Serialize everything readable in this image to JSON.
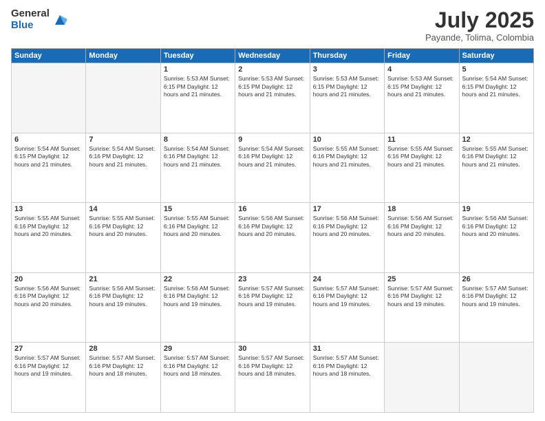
{
  "logo": {
    "general": "General",
    "blue": "Blue"
  },
  "header": {
    "month": "July 2025",
    "location": "Payande, Tolima, Colombia"
  },
  "weekdays": [
    "Sunday",
    "Monday",
    "Tuesday",
    "Wednesday",
    "Thursday",
    "Friday",
    "Saturday"
  ],
  "weeks": [
    [
      {
        "day": "",
        "empty": true
      },
      {
        "day": "",
        "empty": true
      },
      {
        "day": "1",
        "info": "Sunrise: 5:53 AM\nSunset: 6:15 PM\nDaylight: 12 hours and 21 minutes."
      },
      {
        "day": "2",
        "info": "Sunrise: 5:53 AM\nSunset: 6:15 PM\nDaylight: 12 hours and 21 minutes."
      },
      {
        "day": "3",
        "info": "Sunrise: 5:53 AM\nSunset: 6:15 PM\nDaylight: 12 hours and 21 minutes."
      },
      {
        "day": "4",
        "info": "Sunrise: 5:53 AM\nSunset: 6:15 PM\nDaylight: 12 hours and 21 minutes."
      },
      {
        "day": "5",
        "info": "Sunrise: 5:54 AM\nSunset: 6:15 PM\nDaylight: 12 hours and 21 minutes."
      }
    ],
    [
      {
        "day": "6",
        "info": "Sunrise: 5:54 AM\nSunset: 6:15 PM\nDaylight: 12 hours and 21 minutes."
      },
      {
        "day": "7",
        "info": "Sunrise: 5:54 AM\nSunset: 6:16 PM\nDaylight: 12 hours and 21 minutes."
      },
      {
        "day": "8",
        "info": "Sunrise: 5:54 AM\nSunset: 6:16 PM\nDaylight: 12 hours and 21 minutes."
      },
      {
        "day": "9",
        "info": "Sunrise: 5:54 AM\nSunset: 6:16 PM\nDaylight: 12 hours and 21 minutes."
      },
      {
        "day": "10",
        "info": "Sunrise: 5:55 AM\nSunset: 6:16 PM\nDaylight: 12 hours and 21 minutes."
      },
      {
        "day": "11",
        "info": "Sunrise: 5:55 AM\nSunset: 6:16 PM\nDaylight: 12 hours and 21 minutes."
      },
      {
        "day": "12",
        "info": "Sunrise: 5:55 AM\nSunset: 6:16 PM\nDaylight: 12 hours and 21 minutes."
      }
    ],
    [
      {
        "day": "13",
        "info": "Sunrise: 5:55 AM\nSunset: 6:16 PM\nDaylight: 12 hours and 20 minutes."
      },
      {
        "day": "14",
        "info": "Sunrise: 5:55 AM\nSunset: 6:16 PM\nDaylight: 12 hours and 20 minutes."
      },
      {
        "day": "15",
        "info": "Sunrise: 5:55 AM\nSunset: 6:16 PM\nDaylight: 12 hours and 20 minutes."
      },
      {
        "day": "16",
        "info": "Sunrise: 5:56 AM\nSunset: 6:16 PM\nDaylight: 12 hours and 20 minutes."
      },
      {
        "day": "17",
        "info": "Sunrise: 5:56 AM\nSunset: 6:16 PM\nDaylight: 12 hours and 20 minutes."
      },
      {
        "day": "18",
        "info": "Sunrise: 5:56 AM\nSunset: 6:16 PM\nDaylight: 12 hours and 20 minutes."
      },
      {
        "day": "19",
        "info": "Sunrise: 5:56 AM\nSunset: 6:16 PM\nDaylight: 12 hours and 20 minutes."
      }
    ],
    [
      {
        "day": "20",
        "info": "Sunrise: 5:56 AM\nSunset: 6:16 PM\nDaylight: 12 hours and 20 minutes."
      },
      {
        "day": "21",
        "info": "Sunrise: 5:56 AM\nSunset: 6:16 PM\nDaylight: 12 hours and 19 minutes."
      },
      {
        "day": "22",
        "info": "Sunrise: 5:56 AM\nSunset: 6:16 PM\nDaylight: 12 hours and 19 minutes."
      },
      {
        "day": "23",
        "info": "Sunrise: 5:57 AM\nSunset: 6:16 PM\nDaylight: 12 hours and 19 minutes."
      },
      {
        "day": "24",
        "info": "Sunrise: 5:57 AM\nSunset: 6:16 PM\nDaylight: 12 hours and 19 minutes."
      },
      {
        "day": "25",
        "info": "Sunrise: 5:57 AM\nSunset: 6:16 PM\nDaylight: 12 hours and 19 minutes."
      },
      {
        "day": "26",
        "info": "Sunrise: 5:57 AM\nSunset: 6:16 PM\nDaylight: 12 hours and 19 minutes."
      }
    ],
    [
      {
        "day": "27",
        "info": "Sunrise: 5:57 AM\nSunset: 6:16 PM\nDaylight: 12 hours and 19 minutes."
      },
      {
        "day": "28",
        "info": "Sunrise: 5:57 AM\nSunset: 6:16 PM\nDaylight: 12 hours and 18 minutes."
      },
      {
        "day": "29",
        "info": "Sunrise: 5:57 AM\nSunset: 6:16 PM\nDaylight: 12 hours and 18 minutes."
      },
      {
        "day": "30",
        "info": "Sunrise: 5:57 AM\nSunset: 6:16 PM\nDaylight: 12 hours and 18 minutes."
      },
      {
        "day": "31",
        "info": "Sunrise: 5:57 AM\nSunset: 6:16 PM\nDaylight: 12 hours and 18 minutes."
      },
      {
        "day": "",
        "empty": true
      },
      {
        "day": "",
        "empty": true
      }
    ]
  ]
}
